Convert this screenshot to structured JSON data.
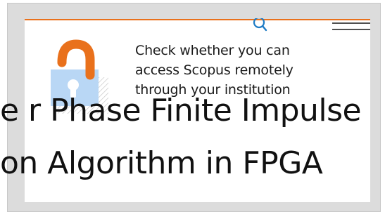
{
  "header": {
    "accent_color": "#e9711c",
    "search_icon": "search-icon",
    "menu_icon": "hamburger-menu-icon"
  },
  "promo": {
    "icon": "unlocked-padlock-icon",
    "lines": [
      "Check whether you can",
      "access Scopus remotely",
      "through your institution"
    ]
  },
  "document_title": {
    "line1": "e r Phase Finite Impulse",
    "line2": "on Algorithm in FPGA"
  },
  "colors": {
    "lock_shackle": "#e9711c",
    "lock_body": "#b9d7f5",
    "lock_hatch": "#c8c8c8"
  }
}
